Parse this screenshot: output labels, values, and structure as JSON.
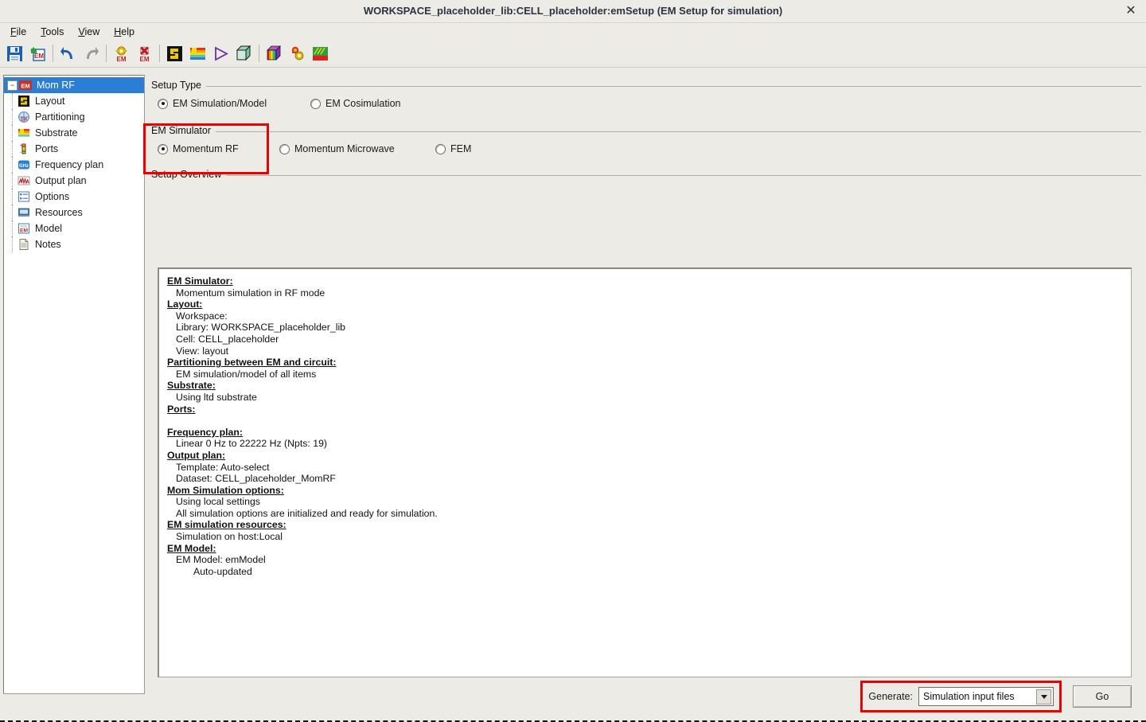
{
  "window": {
    "title": "WORKSPACE_placeholder_lib:CELL_placeholder:emSetup (EM Setup for simulation)",
    "close_label": "✕"
  },
  "menubar": {
    "items": [
      {
        "label": "File",
        "mnemonic": "F"
      },
      {
        "label": "Tools",
        "mnemonic": "T"
      },
      {
        "label": "View",
        "mnemonic": "V"
      },
      {
        "label": "Help",
        "mnemonic": "H"
      }
    ]
  },
  "toolbar": {
    "items": [
      {
        "name": "save-icon",
        "title": "Save"
      },
      {
        "name": "save-em-icon",
        "title": "Save EM Setup"
      },
      {
        "name": "undo-icon",
        "title": "Undo"
      },
      {
        "name": "redo-icon",
        "title": "Redo"
      },
      {
        "name": "em-settings-icon",
        "title": "EM Settings"
      },
      {
        "name": "em-delete-icon",
        "title": "Delete EM Setup"
      },
      {
        "name": "layout-icon",
        "title": "Layout"
      },
      {
        "name": "substrate-icon",
        "title": "Substrate"
      },
      {
        "name": "simulate-icon",
        "title": "Simulate"
      },
      {
        "name": "3d-view-icon",
        "title": "3D View"
      },
      {
        "name": "visualization-icon",
        "title": "Visualization"
      },
      {
        "name": "em-model-icon",
        "title": "EM Model"
      },
      {
        "name": "em-cosim-icon",
        "title": "EM Cosimulation"
      }
    ]
  },
  "sidebar": {
    "root": {
      "label": "Mom RF",
      "icon": "em-icon",
      "selected": true,
      "expanded": true
    },
    "items": [
      {
        "label": "Layout",
        "icon": "layout-icon"
      },
      {
        "label": "Partitioning",
        "icon": "partitioning-icon"
      },
      {
        "label": "Substrate",
        "icon": "substrate-icon"
      },
      {
        "label": "Ports",
        "icon": "ports-icon"
      },
      {
        "label": "Frequency plan",
        "icon": "ghz-icon"
      },
      {
        "label": "Output plan",
        "icon": "output-plan-icon"
      },
      {
        "label": "Options",
        "icon": "options-icon"
      },
      {
        "label": "Resources",
        "icon": "resources-icon"
      },
      {
        "label": "Model",
        "icon": "model-icon"
      },
      {
        "label": "Notes",
        "icon": "notes-icon"
      }
    ]
  },
  "setup_type": {
    "group_label": "Setup Type",
    "options": [
      {
        "label": "EM Simulation/Model",
        "selected": true
      },
      {
        "label": "EM Cosimulation",
        "selected": false
      }
    ]
  },
  "em_simulator": {
    "group_label": "EM Simulator",
    "highlighted": true,
    "highlight_color": "#ee0000",
    "options": [
      {
        "label": "Momentum RF",
        "selected": true
      },
      {
        "label": "Momentum Microwave",
        "selected": false
      },
      {
        "label": "FEM",
        "selected": false
      }
    ]
  },
  "setup_overview": {
    "group_label": "Setup Overview",
    "lines": [
      {
        "text": "EM Simulator:",
        "heading": true,
        "indent": 0
      },
      {
        "text": "Momentum simulation in RF mode",
        "heading": false,
        "indent": 1
      },
      {
        "text": "Layout:",
        "heading": true,
        "indent": 0
      },
      {
        "text": "Workspace:",
        "heading": false,
        "indent": 1
      },
      {
        "text": "Library: WORKSPACE_placeholder_lib",
        "heading": false,
        "indent": 1
      },
      {
        "text": "Cell: CELL_placeholder",
        "heading": false,
        "indent": 1
      },
      {
        "text": "View: layout",
        "heading": false,
        "indent": 1
      },
      {
        "text": "Partitioning between EM and circuit:",
        "heading": true,
        "indent": 0
      },
      {
        "text": "EM simulation/model of all items",
        "heading": false,
        "indent": 1
      },
      {
        "text": "Substrate:",
        "heading": true,
        "indent": 0
      },
      {
        "text": "Using ltd substrate",
        "heading": false,
        "indent": 1
      },
      {
        "text": "Ports:",
        "heading": true,
        "indent": 0
      },
      {
        "text": "",
        "heading": false,
        "indent": 0
      },
      {
        "text": "Frequency plan:",
        "heading": true,
        "indent": 0
      },
      {
        "text": "Linear 0 Hz to 22222 Hz (Npts: 19)",
        "heading": false,
        "indent": 1
      },
      {
        "text": "Output plan:",
        "heading": true,
        "indent": 0
      },
      {
        "text": "Template: Auto-select",
        "heading": false,
        "indent": 1
      },
      {
        "text": "Dataset: CELL_placeholder_MomRF",
        "heading": false,
        "indent": 1
      },
      {
        "text": "Mom Simulation options:",
        "heading": true,
        "indent": 0
      },
      {
        "text": "Using local settings",
        "heading": false,
        "indent": 1
      },
      {
        "text": "All simulation options are initialized and ready for simulation.",
        "heading": false,
        "indent": 1
      },
      {
        "text": "EM simulation resources:",
        "heading": true,
        "indent": 0
      },
      {
        "text": "Simulation on host:Local",
        "heading": false,
        "indent": 1
      },
      {
        "text": "EM Model:",
        "heading": true,
        "indent": 0
      },
      {
        "text": "EM Model: emModel",
        "heading": false,
        "indent": 1
      },
      {
        "text": "Auto-updated",
        "heading": false,
        "indent": 3
      }
    ]
  },
  "bottom_bar": {
    "generate_label": "Generate:",
    "generate_value": "Simulation input files",
    "generate_options": [
      "Simulation input files"
    ],
    "go_label": "Go",
    "highlight_color": "#ee0000"
  }
}
